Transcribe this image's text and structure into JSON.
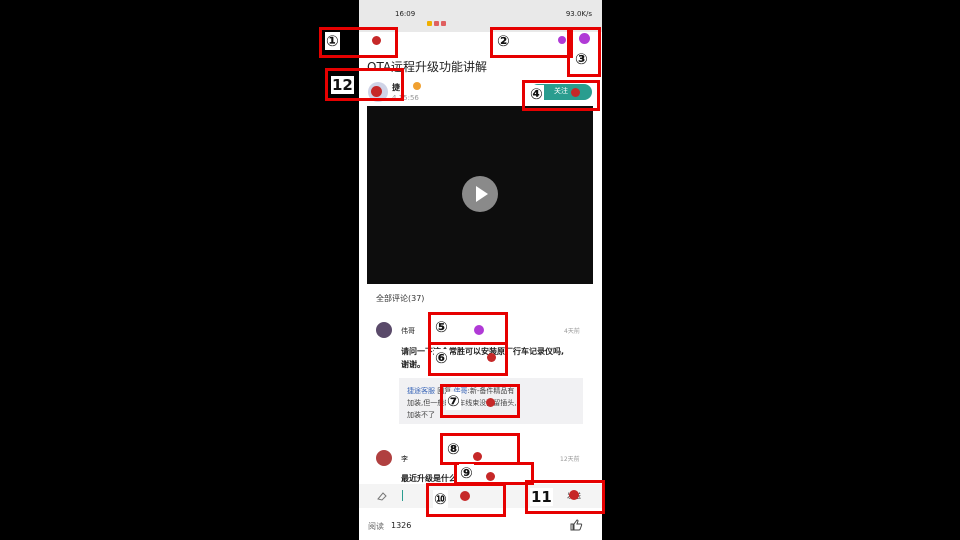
{
  "status_bar": {
    "time": "16:09",
    "dots": "...",
    "right": "93.0K/s"
  },
  "post": {
    "title": "OTA远程升级功能讲解",
    "author": "捷",
    "time": "4 15:56",
    "follow_label": "关注"
  },
  "comments": {
    "header": "全部评论(37)",
    "items": [
      {
        "name": "伟哥",
        "time": "4天前",
        "text_line1": "请问一下这个常胜可以安装原厂行车记录仪吗,",
        "text_line2": "谢谢。"
      },
      {
        "name": "李",
        "time": "12天前",
        "text_line1": "最近升级是什么",
        "text_line2": ""
      }
    ],
    "reply": {
      "author": "捷途客服",
      "mid": "回复",
      "target": "伟哥",
      "line1_rest": ":新-备件精品有",
      "line2": "加装,但一般的原车线束没预留插头,",
      "line3": "加装不了"
    }
  },
  "input": {
    "placeholder": "",
    "send_label": "发送"
  },
  "bottom": {
    "read_label": "阅读",
    "read_count": "1326"
  },
  "annotations": [
    {
      "label": "①"
    },
    {
      "label": "②"
    },
    {
      "label": "③"
    },
    {
      "label": "④"
    },
    {
      "label": "⑤"
    },
    {
      "label": "⑥"
    },
    {
      "label": "⑦"
    },
    {
      "label": "⑧"
    },
    {
      "label": "⑨"
    },
    {
      "label": "⑩"
    },
    {
      "label": "11"
    },
    {
      "label": "12"
    }
  ],
  "colors": {
    "annotation": "#e60000",
    "accent": "#2a9d8f",
    "dot_red": "#c62828",
    "dot_purple": "#b03ad6"
  }
}
